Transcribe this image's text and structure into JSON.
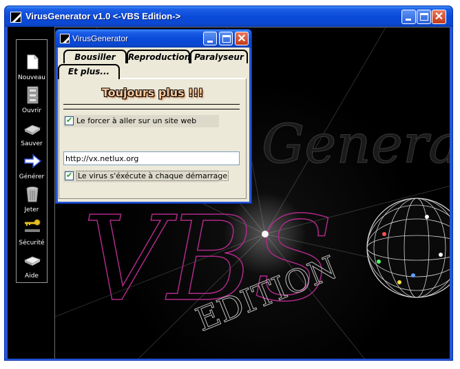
{
  "window": {
    "title": "VirusGenerator v1.0 <-VBS Edition->",
    "accent": "#0a4ad8"
  },
  "toolbar": {
    "items": [
      {
        "label": "Nouveau",
        "icon": "new-document-icon"
      },
      {
        "label": "Ouvrir",
        "icon": "open-cabinet-icon"
      },
      {
        "label": "Sauver",
        "icon": "save-disk-icon"
      },
      {
        "label": "Générer",
        "icon": "generate-arrow-icon"
      },
      {
        "label": "Jeter",
        "icon": "trash-icon"
      },
      {
        "label": "Sécurité",
        "icon": "key-icon"
      },
      {
        "label": "Aide",
        "icon": "help-book-icon"
      }
    ]
  },
  "dialog": {
    "title": "VirusGenerator",
    "tabs": [
      "Bousiller",
      "Reproduction",
      "Paralyseur",
      "Et plus..."
    ],
    "active_tab": "Et plus...",
    "banner": "Toujours plus !!!",
    "option_web": "Le forcer à aller sur un site web",
    "url_value": "http://vx.netlux.org",
    "option_startup": "Le virus s'éxécute à chaque démarrage"
  },
  "background": {
    "logo_text": "Generator",
    "vbs_text": "VBS",
    "edition_text": "EDITION"
  }
}
